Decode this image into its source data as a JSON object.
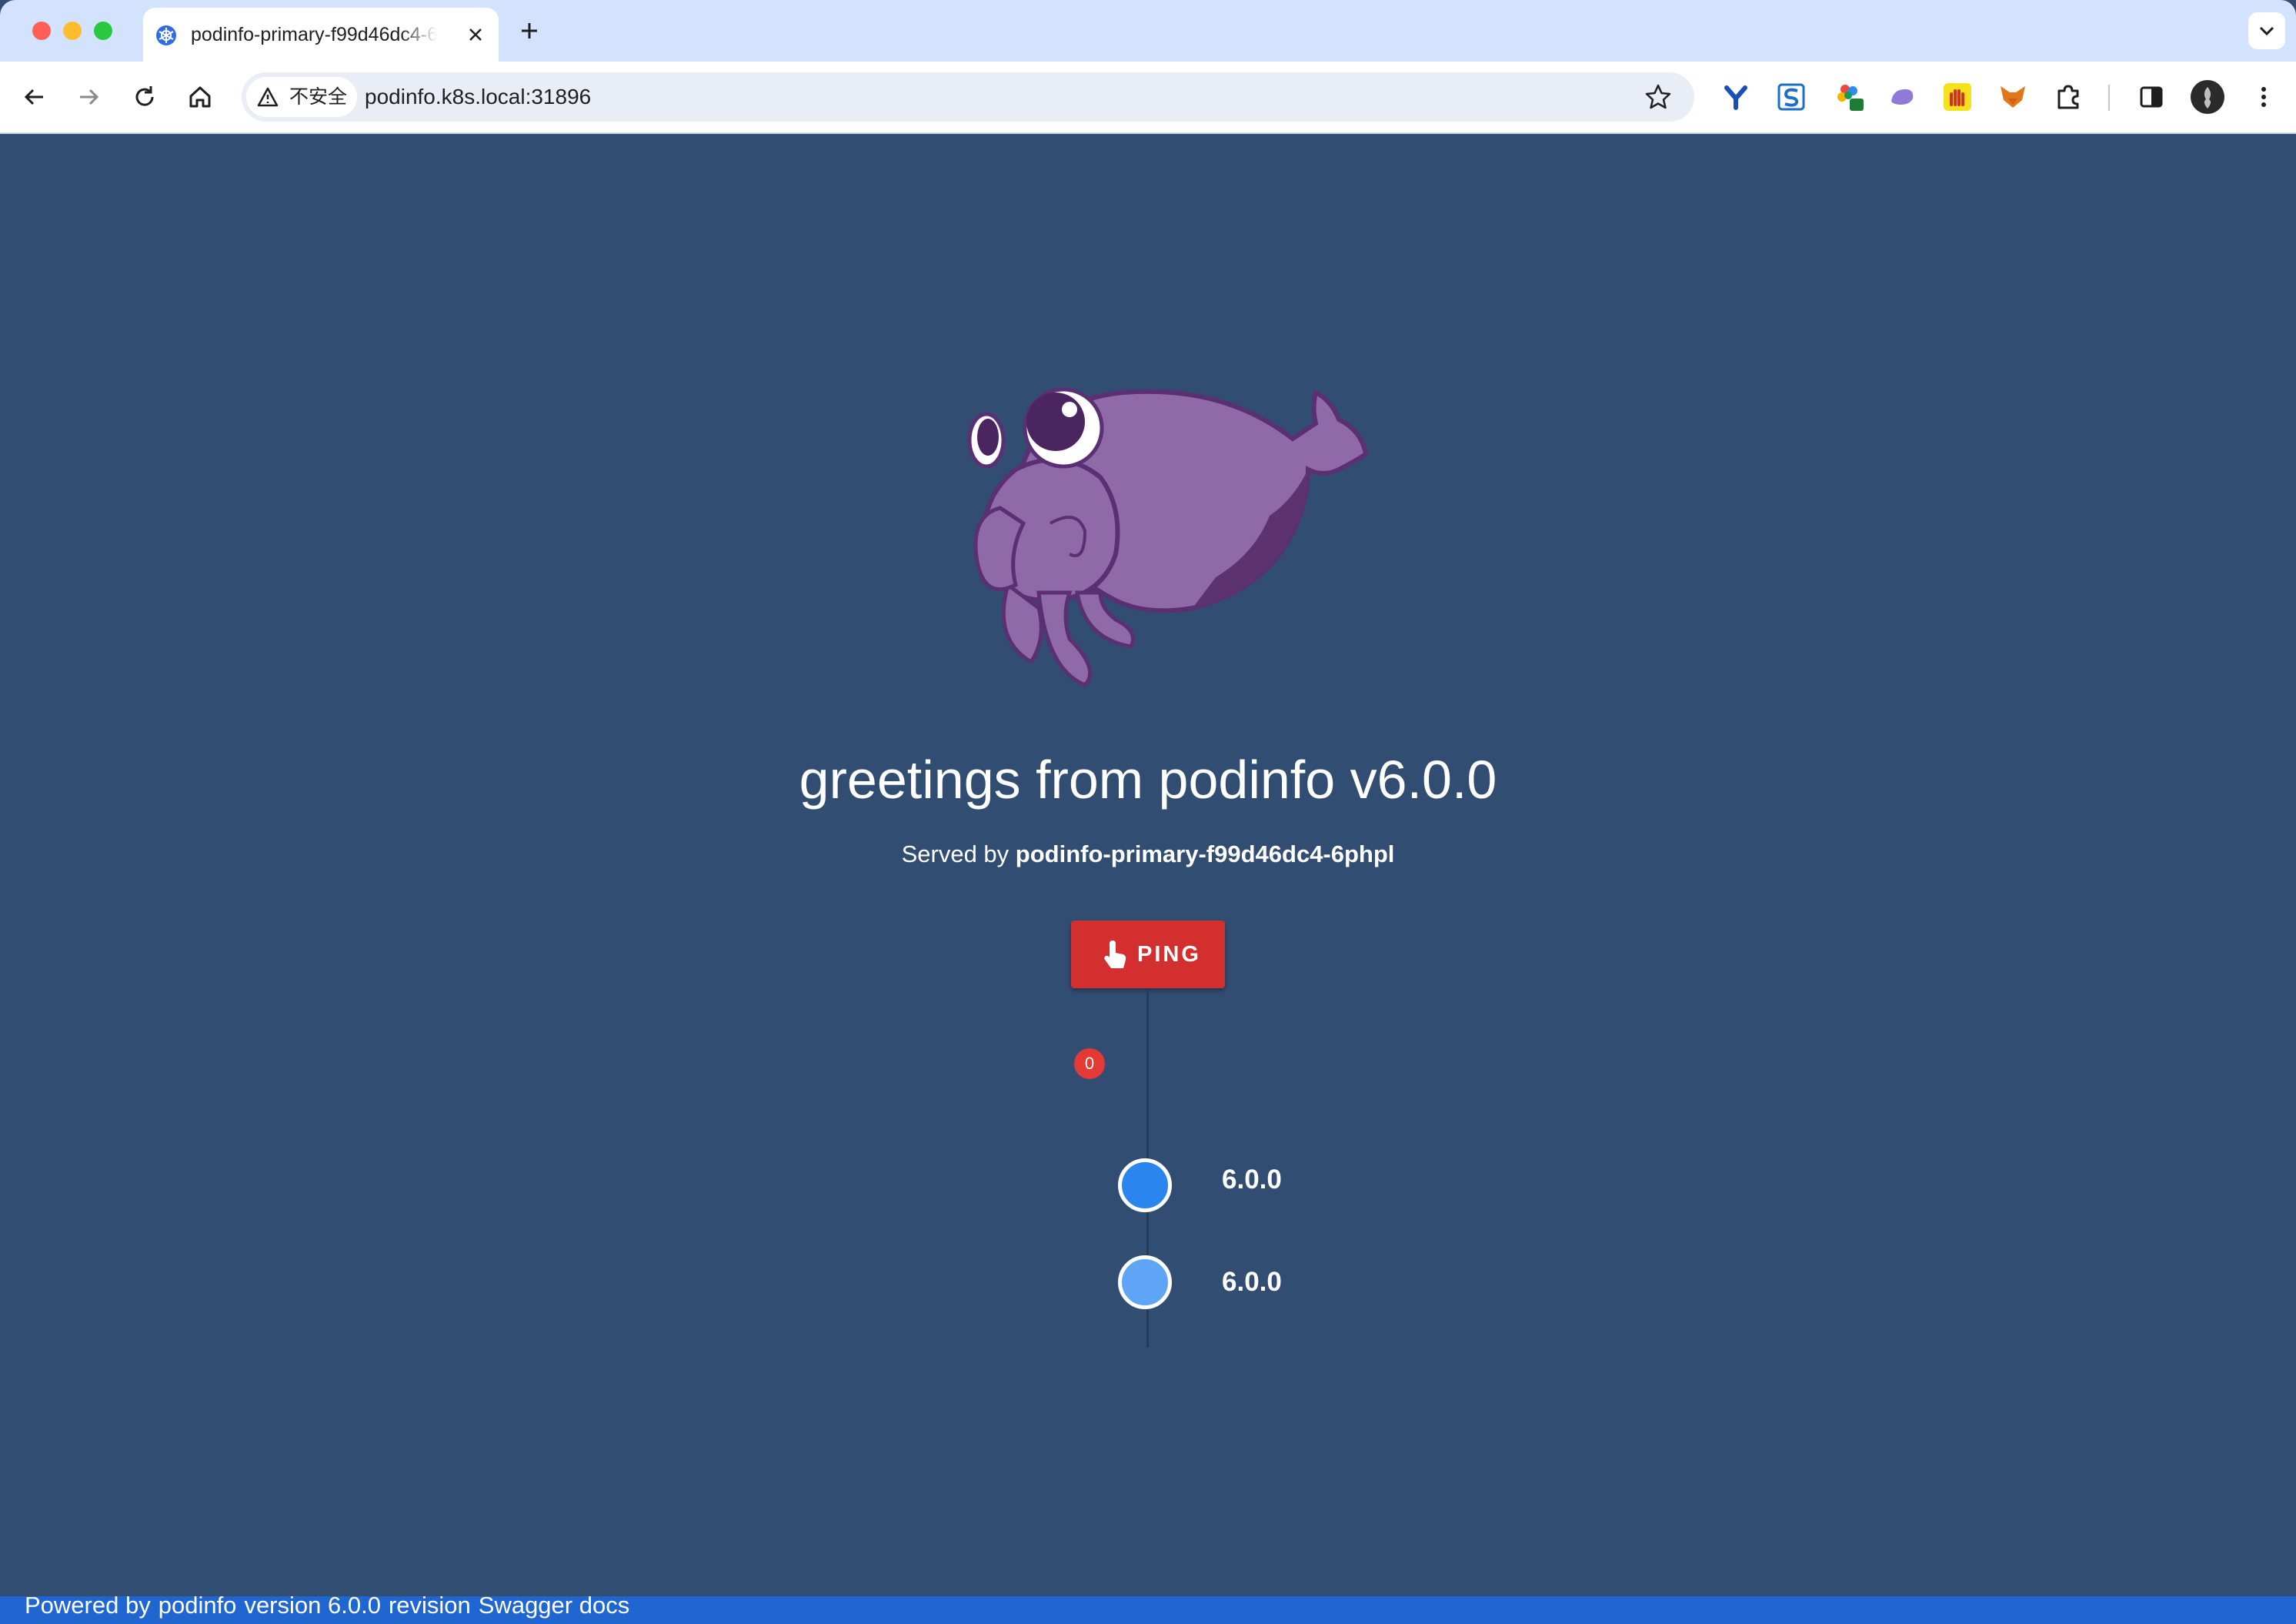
{
  "browser": {
    "tab": {
      "title": "podinfo-primary-f99d46dc4-6phpl",
      "favicon": "kubernetes-wheel-icon"
    },
    "toolbar": {
      "security_label": "不安全",
      "url": "podinfo.k8s.local:31896",
      "extensions": [
        "y-extension-icon",
        "s-extension-icon",
        "flower-extension-icon",
        "whale-extension-icon",
        "hand-extension-icon",
        "fox-extension-icon",
        "puzzle-extensions-icon"
      ],
      "profile": "avatar"
    }
  },
  "main": {
    "greeting": "greetings from podinfo v6.0.0",
    "served_by_prefix": "Served by",
    "served_by_host": "podinfo-primary-f99d46dc4-6phpl",
    "ping": {
      "label": "PING",
      "badge_count": "0",
      "color": "#d32f2f"
    },
    "timeline": [
      {
        "version": "6.0.0",
        "color": "#2a86ee"
      },
      {
        "version": "6.0.0",
        "color": "#5ea6f5"
      }
    ],
    "background_color": "#324d72"
  },
  "footer": {
    "powered_by": "Powered by",
    "podinfo_link": "podinfo",
    "version_text": "version 6.0.0",
    "revision_link": "revision",
    "swagger_link": "Swagger docs",
    "color": "#1f66d1"
  }
}
